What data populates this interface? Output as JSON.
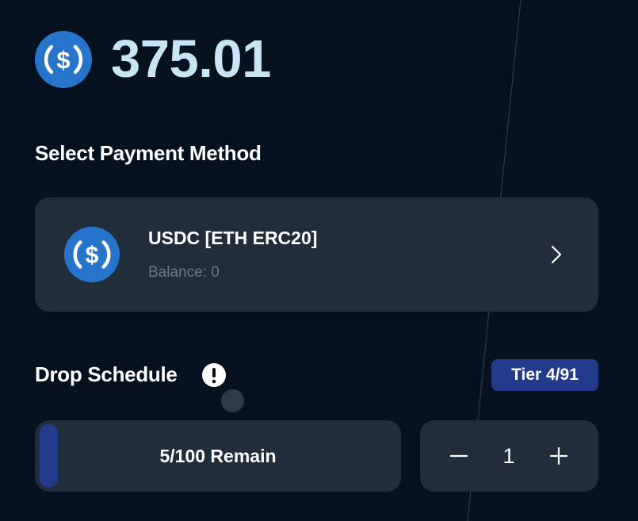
{
  "header": {
    "price": "375.01",
    "icon": "usdc-coin-icon"
  },
  "payment": {
    "section_title": "Select Payment Method",
    "method_name": "USDC [ETH ERC20]",
    "balance": "Balance: 0",
    "icon": "usdc-coin-icon"
  },
  "drop": {
    "section_title": "Drop Schedule",
    "tier_badge": "Tier 4/91",
    "remain_label": "5/100 Remain",
    "remain_fraction": 0.05
  },
  "quantity": {
    "value": "1",
    "minus_icon": "minus-icon",
    "plus_icon": "plus-icon"
  },
  "colors": {
    "background": "#06111f",
    "card": "#222d3b",
    "accent_blue": "#2775ca",
    "price_text": "#c6e6f6",
    "badge": "#233a8c"
  }
}
